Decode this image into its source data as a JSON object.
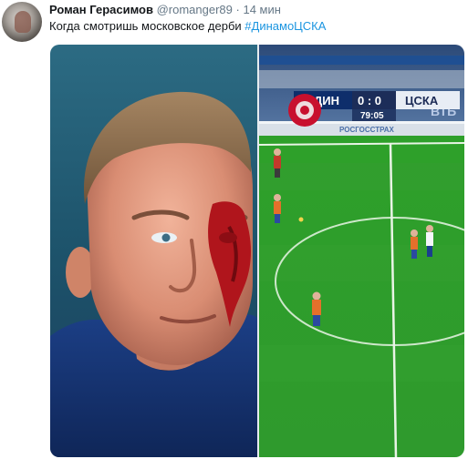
{
  "tweet": {
    "author_name": "Роман Герасимов",
    "handle": "@romanger89",
    "separator": "·",
    "time": "14 мин",
    "text": "Когда смотришь московское дерби ",
    "hashtag": "#ДинамоЦСКА"
  },
  "media": {
    "scoreboard": {
      "team_home": "ДИН",
      "score": "0 : 0",
      "team_away": "ЦСКА",
      "clock": "79:05",
      "sponsor_right": "ВТБ",
      "board_text": "РОСГОССТРАХ"
    }
  },
  "colors": {
    "link": "#1b95e0",
    "secondary_text": "#657786",
    "pitch_green": "#2f9a2d"
  }
}
